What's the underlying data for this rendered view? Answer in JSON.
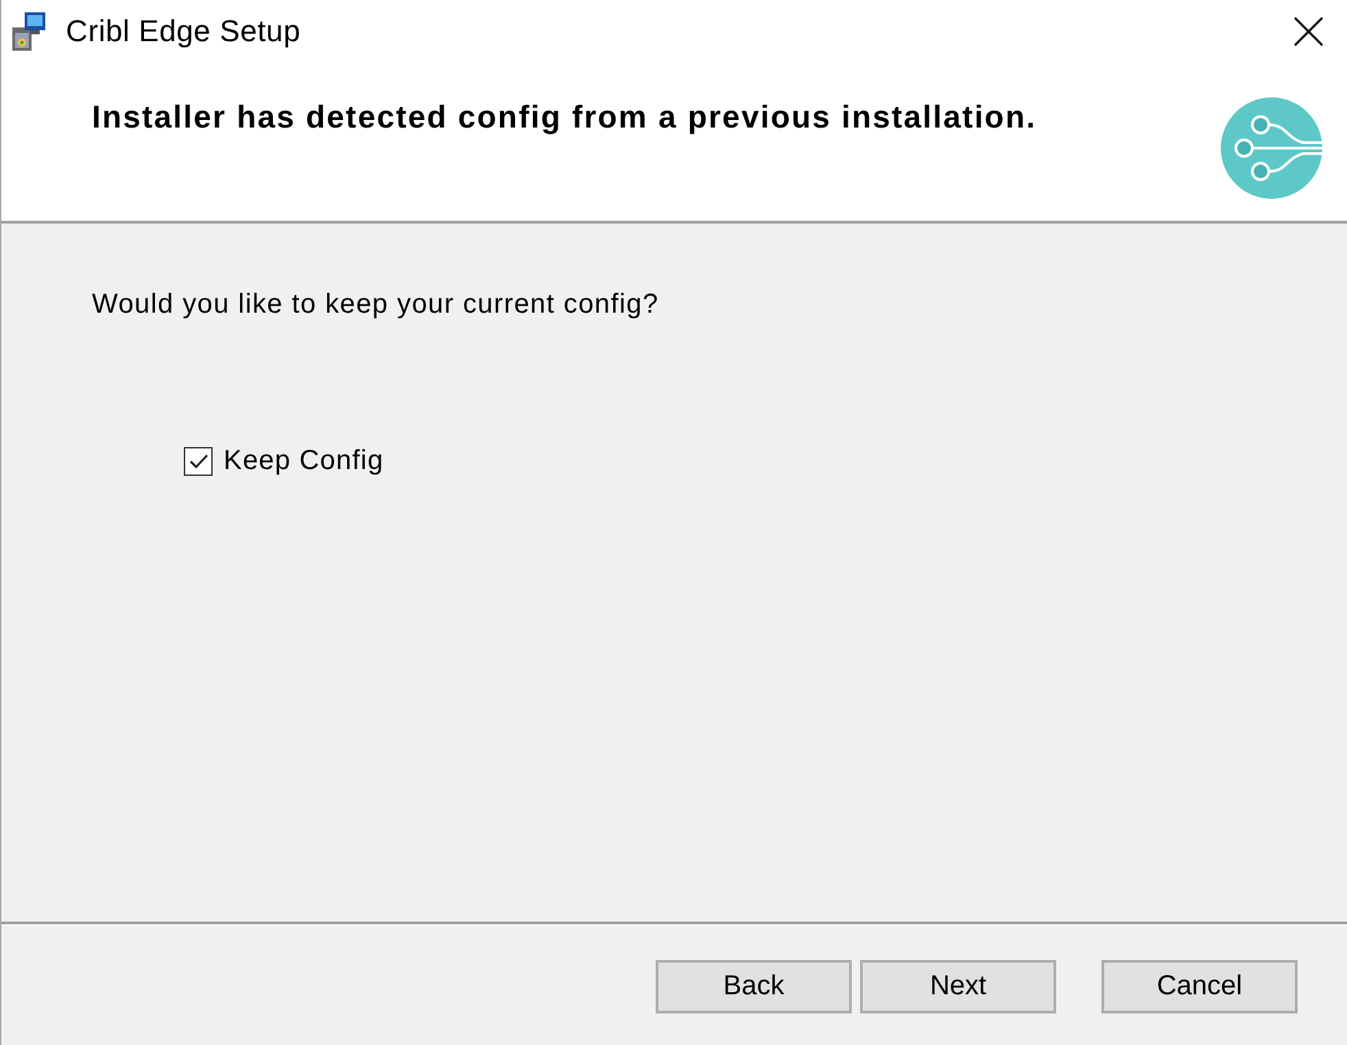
{
  "window": {
    "title": "Cribl Edge Setup"
  },
  "header": {
    "heading": "Installer has detected config from a previous installation."
  },
  "body": {
    "question": "Would you like to keep your current config?",
    "options": [
      {
        "label": "Keep Config",
        "checked": true
      }
    ]
  },
  "footer": {
    "nav_buttons": [
      "Back",
      "Next"
    ],
    "cancel_button": "Cancel"
  }
}
